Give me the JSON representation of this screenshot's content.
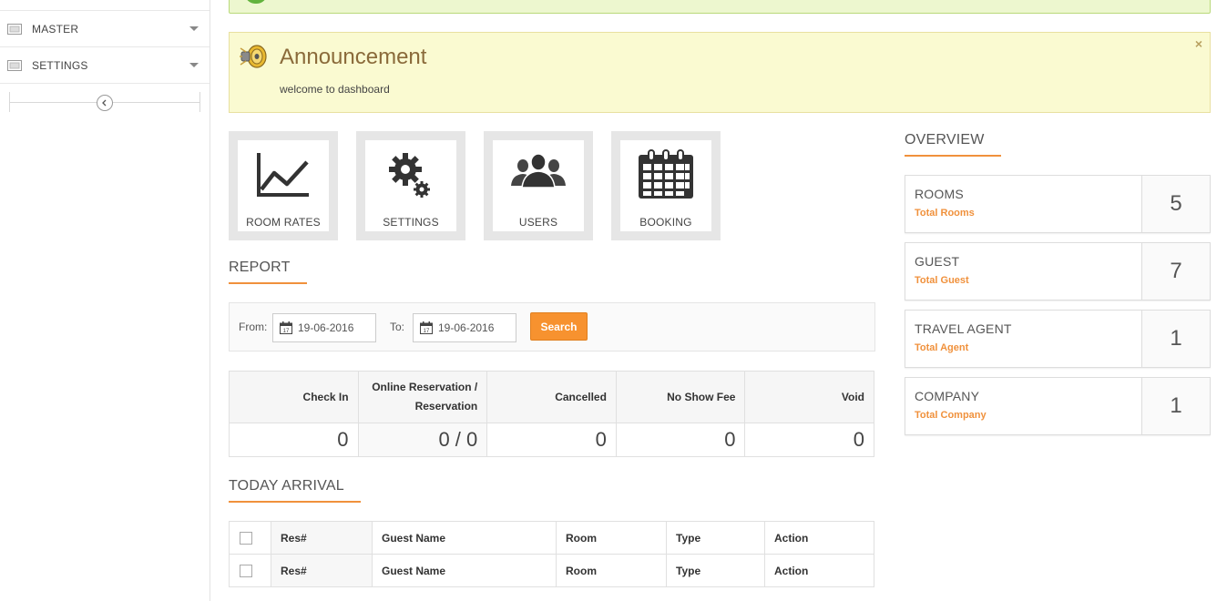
{
  "sidebar": {
    "items": [
      {
        "label": "MASTER",
        "icon": "image-icon"
      },
      {
        "label": "SETTINGS",
        "icon": "image-icon"
      }
    ]
  },
  "announcement": {
    "title": "Announcement",
    "message": "welcome to dashboard",
    "close": "×"
  },
  "tiles": [
    {
      "label": "ROOM RATES",
      "icon": "chart-icon"
    },
    {
      "label": "SETTINGS",
      "icon": "gears-icon"
    },
    {
      "label": "USERS",
      "icon": "users-icon"
    },
    {
      "label": "BOOKING",
      "icon": "calendar-icon"
    }
  ],
  "report": {
    "title": "REPORT",
    "from_label": "From:",
    "from_value": "19-06-2016",
    "to_label": "To:",
    "to_value": "19-06-2016",
    "search_label": "Search",
    "headers": [
      "Check In",
      "Online Reservation / Reservation",
      "Cancelled",
      "No Show Fee",
      "Void"
    ],
    "values": [
      "0",
      "0 / 0",
      "0",
      "0",
      "0"
    ]
  },
  "today_arrival": {
    "title": "TODAY ARRIVAL",
    "columns": [
      "Res#",
      "Guest Name",
      "Room",
      "Type",
      "Action"
    ],
    "rows": [
      [
        "Res#",
        "Guest Name",
        "Room",
        "Type",
        "Action"
      ],
      [
        "Res#",
        "Guest Name",
        "Room",
        "Type",
        "Action"
      ]
    ]
  },
  "overview": {
    "title": "OVERVIEW",
    "cards": [
      {
        "name": "ROOMS",
        "sub": "Total Rooms",
        "value": "5"
      },
      {
        "name": "GUEST",
        "sub": "Total Guest",
        "value": "7"
      },
      {
        "name": "TRAVEL AGENT",
        "sub": "Total Agent",
        "value": "1"
      },
      {
        "name": "COMPANY",
        "sub": "Total Company",
        "value": "1"
      }
    ]
  },
  "colors": {
    "accent": "#f0913c",
    "announce_bg": "#fafad1",
    "success_bg": "#edf7cf"
  }
}
